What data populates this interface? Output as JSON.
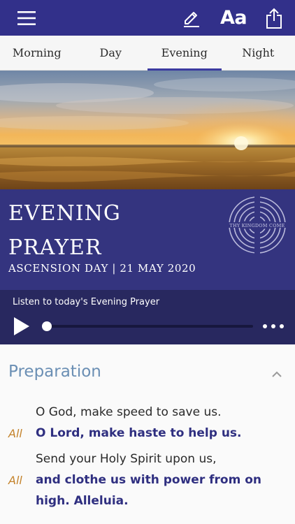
{
  "tabs": [
    {
      "label": "Morning",
      "active": false
    },
    {
      "label": "Day",
      "active": false
    },
    {
      "label": "Evening",
      "active": true
    },
    {
      "label": "Night",
      "active": false
    }
  ],
  "toolbar": {
    "font_label": "Aa"
  },
  "header": {
    "title_line1": "EVENING",
    "title_line2": "PRAYER",
    "subtitle": "ASCENSION DAY | 21 MAY 2020",
    "logo_text": "THY KINGDOM COME"
  },
  "player": {
    "label": "Listen to today's Evening Prayer",
    "progress": 0
  },
  "section": {
    "title": "Preparation",
    "lines": [
      {
        "speaker": "",
        "text": "O God, make speed to save us.",
        "bold": false
      },
      {
        "speaker": "All",
        "text": "O Lord, make haste to help us.",
        "bold": true
      },
      {
        "speaker": "",
        "text": "Send your Holy Spirit upon us,",
        "bold": false
      },
      {
        "speaker": "All",
        "text": "and clothe us with power from on",
        "bold": true
      },
      {
        "speaker": "",
        "text": "high. Alleluia.",
        "bold": true
      }
    ]
  },
  "colors": {
    "brand": "#32308a",
    "accent": "#c4832c",
    "section_heading": "#6b8fb4"
  }
}
